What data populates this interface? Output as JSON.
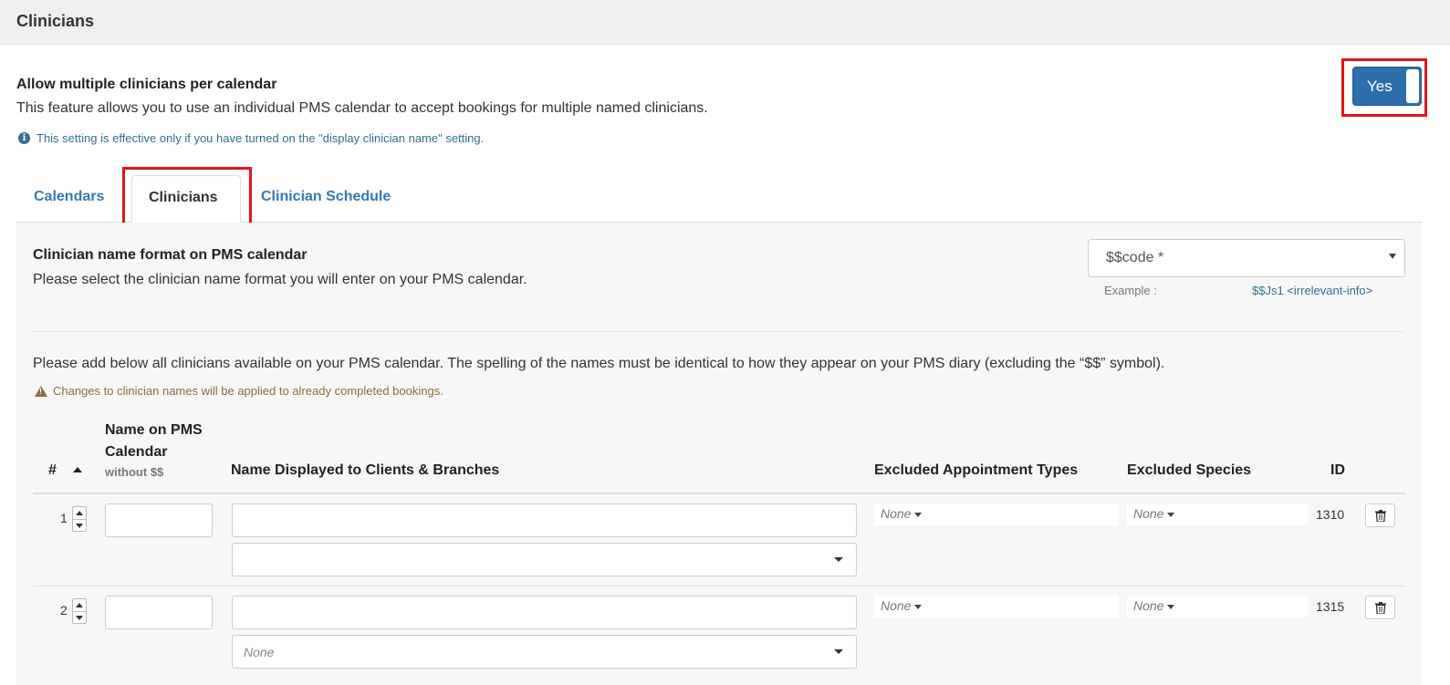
{
  "header": {
    "title": "Clinicians"
  },
  "setting": {
    "title": "Allow multiple clinicians per calendar",
    "description": "This feature allows you to use an individual PMS calendar to accept bookings for multiple named clinicians.",
    "note": "This setting is effective only if you have turned on the \"display clinician name\" setting.",
    "toggle_label": "Yes",
    "toggle_state": "on"
  },
  "tabs": [
    {
      "label": "Calendars",
      "active": false
    },
    {
      "label": "Clinicians",
      "active": true
    },
    {
      "label": "Clinician Schedule",
      "active": false
    }
  ],
  "name_format": {
    "title": "Clinician name format on PMS calendar",
    "description": "Please select the clinician name format you will enter on your PMS calendar.",
    "selected": "$$code *",
    "example_label": "Example :",
    "example_value": "$$Js1 <irrelevant-info>"
  },
  "instructions": "Please add below all clinicians available on your PMS calendar. The spelling of the names must be identical to how they appear on your PMS diary (excluding the “$$” symbol).",
  "warning": "Changes to clinician names will be applied to already completed bookings.",
  "table": {
    "columns": {
      "hash": "#",
      "pms_name": "Name on PMS Calendar",
      "pms_name_sub": "without $$",
      "display_name": "Name Displayed to Clients & Branches",
      "excluded_appt": "Excluded Appointment Types",
      "excluded_species": "Excluded Species",
      "id": "ID"
    },
    "rows": [
      {
        "num": "1",
        "pms_name": "",
        "display_name": "",
        "branch": "",
        "excluded_appt": "None",
        "excluded_species": "None",
        "id": "1310"
      },
      {
        "num": "2",
        "pms_name": "",
        "display_name": "",
        "branch": "None",
        "excluded_appt": "None",
        "excluded_species": "None",
        "id": "1315"
      }
    ]
  },
  "colors": {
    "accent": "#2d6fad",
    "link": "#337ab7",
    "highlight": "#e0141b",
    "info": "#31708f",
    "warning": "#8a6d3b"
  }
}
